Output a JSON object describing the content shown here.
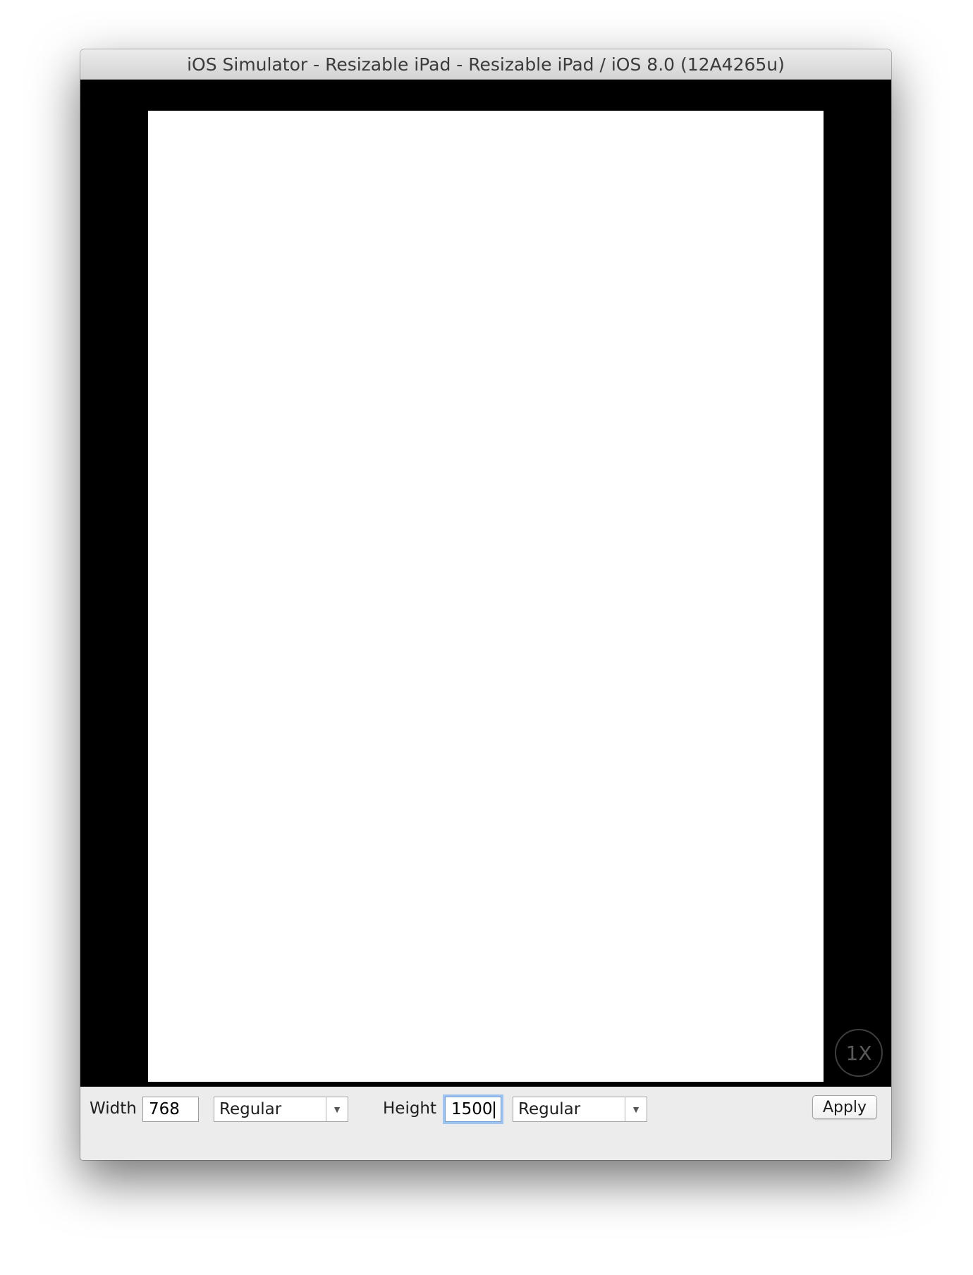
{
  "window": {
    "title": "iOS Simulator - Resizable iPad - Resizable iPad / iOS 8.0 (12A4265u)"
  },
  "screen": {
    "zoom_label": "1X"
  },
  "toolbar": {
    "width_label": "Width",
    "width_value": "768",
    "width_class": "Regular",
    "height_label": "Height",
    "height_value": "1500",
    "height_class": "Regular",
    "apply_label": "Apply"
  },
  "icons": {
    "dropdown": "chevron-down-icon"
  },
  "colors": {
    "device_bezel": "#000000",
    "device_screen": "#ffffff",
    "focus_ring": "#9ec3ef"
  }
}
